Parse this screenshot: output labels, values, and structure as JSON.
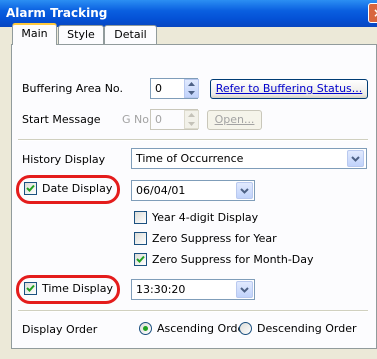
{
  "window": {
    "title": "Alarm Tracking",
    "close_glyph": "×"
  },
  "tabs": [
    {
      "label": "Main",
      "active": true
    },
    {
      "label": "Style",
      "active": false
    },
    {
      "label": "Detail",
      "active": false
    }
  ],
  "buffering": {
    "label": "Buffering Area No.",
    "value": "0",
    "refer_button": "Refer to Buffering Status..."
  },
  "start_message": {
    "label": "Start Message",
    "gno_label": "G No.",
    "value": "0",
    "open_button": "Open..."
  },
  "history_display": {
    "label": "History Display",
    "selected": "Time of Occurrence"
  },
  "date_display": {
    "label": "Date Display",
    "checked": true,
    "selected": "06/04/01",
    "options": [
      {
        "label": "Year 4-digit Display",
        "checked": false
      },
      {
        "label": "Zero Suppress for Year",
        "checked": false
      },
      {
        "label": "Zero Suppress for Month-Day",
        "checked": true
      }
    ]
  },
  "time_display": {
    "label": "Time Display",
    "checked": true,
    "selected": "13:30:20"
  },
  "display_order": {
    "label": "Display Order",
    "options": [
      {
        "label": "Ascending Order",
        "selected": true
      },
      {
        "label": "Descending Order",
        "selected": false
      }
    ]
  },
  "colors": {
    "titlebar": "#0a5fe0",
    "highlight_oval": "#e41c1c",
    "check_mark": "#21a121",
    "link": "#0000cc"
  }
}
